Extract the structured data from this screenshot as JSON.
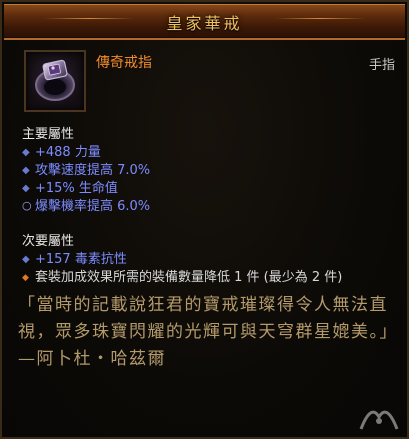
{
  "header": {
    "title": "皇家華戒"
  },
  "item": {
    "name": "傳奇戒指",
    "slot": "手指",
    "icon": "ring-icon"
  },
  "primary": {
    "heading": "主要屬性",
    "stats": [
      {
        "text": "+488 力量",
        "bullet": "diamond"
      },
      {
        "text": "攻擊速度提高 7.0%",
        "bullet": "diamond"
      },
      {
        "text": "+15% 生命值",
        "bullet": "diamond"
      },
      {
        "text": "爆擊機率提高 6.0%",
        "bullet": "ring"
      }
    ]
  },
  "secondary": {
    "heading": "次要屬性",
    "stats": [
      {
        "text": "+157 毒素抗性",
        "bullet": "diamond"
      }
    ],
    "set_bonus": "套裝加成效果所需的裝備數量降低 1 件 (最少為 2 件)"
  },
  "flavor": {
    "text": "「當時的記載說狂君的寶戒璀璨得令人無法直視，眾多珠寶閃耀的光輝可與天穹群星媲美。」 —阿卜杜・哈茲爾"
  },
  "colors": {
    "title": "#f0c060",
    "legendary_name": "#f08a2c",
    "magic_stat": "#7c8cff",
    "flavor": "#b49a6a"
  }
}
